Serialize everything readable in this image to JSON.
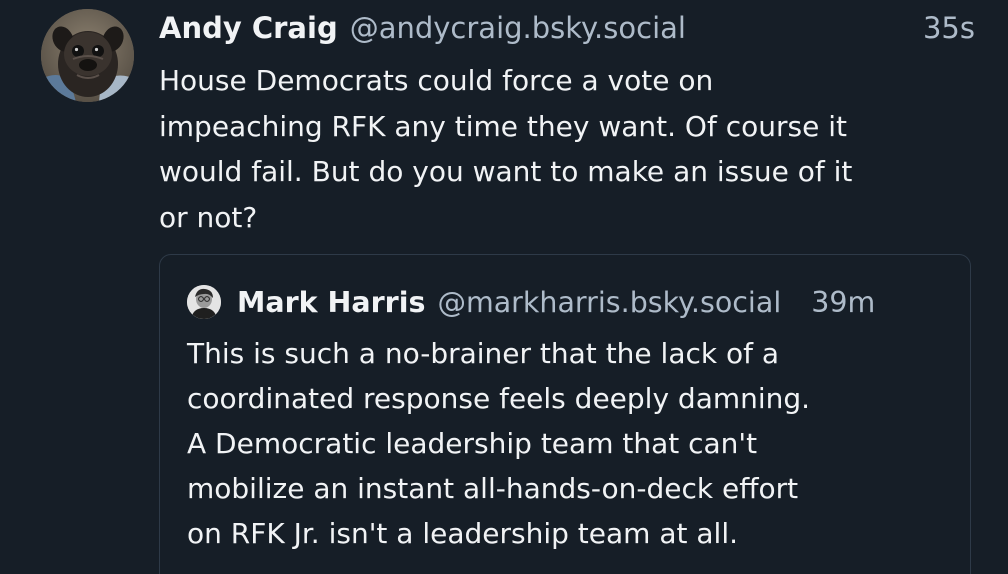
{
  "post": {
    "author_name": "Andy Craig",
    "author_handle": "@andycraig.bsky.social",
    "timestamp": "35s",
    "avatar_icon": "pug-avatar-icon",
    "text": "House Democrats could force a vote on\nimpeaching RFK any time they want. Of course it\nwould fail. But do you want to make an issue of it\nor not?"
  },
  "quote": {
    "author_name": "Mark Harris",
    "author_handle": "@markharris.bsky.social",
    "timestamp": "39m",
    "avatar_icon": "person-avatar-icon",
    "text": "This is such a no-brainer that the lack of a\ncoordinated response feels deeply damning.\nA Democratic leadership team that can't\nmobilize an instant all-hands-on-deck effort\non RFK Jr.  isn't a leadership team at all."
  },
  "colors": {
    "background": "#161e27",
    "text_primary": "#f1f3f5",
    "text_secondary": "#aebbc9",
    "border": "#2e3a48"
  }
}
